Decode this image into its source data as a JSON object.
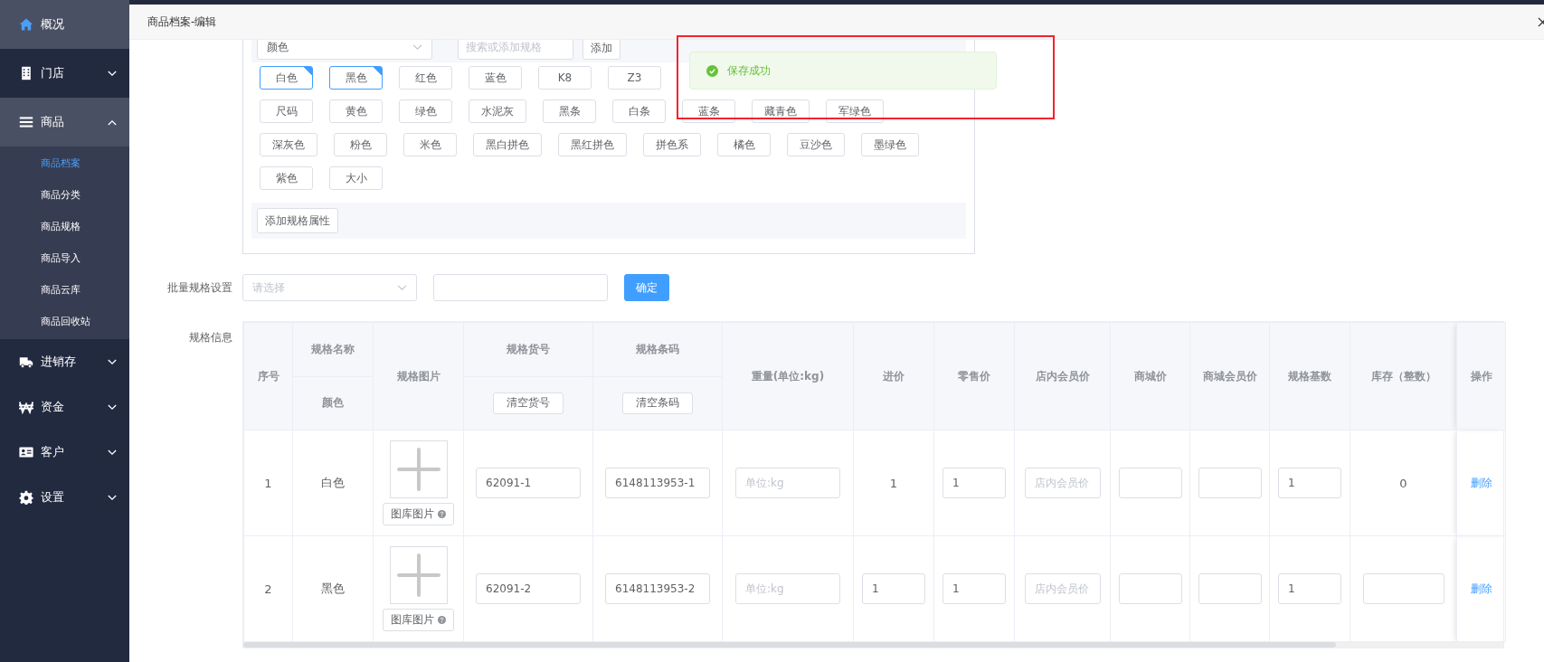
{
  "sidebar": {
    "items": [
      {
        "label": "概况",
        "highlighted": true
      },
      {
        "label": "门店",
        "highlighted": false,
        "expanded": false
      },
      {
        "label": "商品",
        "highlighted": true,
        "expanded": true,
        "children": [
          {
            "label": "商品档案",
            "selected": true
          },
          {
            "label": "商品分类",
            "selected": false
          },
          {
            "label": "商品规格",
            "selected": false
          },
          {
            "label": "商品导入",
            "selected": false
          },
          {
            "label": "商品云库",
            "selected": false
          },
          {
            "label": "商品回收站",
            "selected": false
          }
        ]
      },
      {
        "label": "进销存",
        "highlighted": false,
        "expanded": false
      },
      {
        "label": "资金",
        "highlighted": false,
        "expanded": false
      },
      {
        "label": "客户",
        "highlighted": false,
        "expanded": false
      },
      {
        "label": "设置",
        "highlighted": false,
        "expanded": false
      }
    ]
  },
  "modal": {
    "title": "商品档案-编辑"
  },
  "spec_panel": {
    "attribute_select": {
      "value": "颜色"
    },
    "search": {
      "placeholder": "搜索或添加规格"
    },
    "add_button": "添加",
    "tag_rows": [
      [
        {
          "label": "白色",
          "selected": true
        },
        {
          "label": "黑色",
          "selected": true
        },
        {
          "label": "红色",
          "selected": false
        },
        {
          "label": "蓝色",
          "selected": false
        },
        {
          "label": "K8",
          "selected": false
        },
        {
          "label": "Z3",
          "selected": false
        }
      ],
      [
        {
          "label": "尺码",
          "selected": false
        },
        {
          "label": "黄色",
          "selected": false
        },
        {
          "label": "绿色",
          "selected": false
        },
        {
          "label": "水泥灰",
          "selected": false
        },
        {
          "label": "黑条",
          "selected": false
        },
        {
          "label": "白条",
          "selected": false
        },
        {
          "label": "蓝条",
          "selected": false
        },
        {
          "label": "藏青色",
          "selected": false
        },
        {
          "label": "军绿色",
          "selected": false
        }
      ],
      [
        {
          "label": "深灰色",
          "selected": false
        },
        {
          "label": "粉色",
          "selected": false
        },
        {
          "label": "米色",
          "selected": false
        },
        {
          "label": "黑白拼色",
          "selected": false
        },
        {
          "label": "黑红拼色",
          "selected": false
        },
        {
          "label": "拼色系",
          "selected": false
        },
        {
          "label": "橘色",
          "selected": false
        },
        {
          "label": "豆沙色",
          "selected": false
        },
        {
          "label": "墨绿色",
          "selected": false
        }
      ],
      [
        {
          "label": "紫色",
          "selected": false
        },
        {
          "label": "大小",
          "selected": false
        }
      ]
    ],
    "add_attribute_button": "添加规格属性"
  },
  "batch": {
    "label": "批量规格设置",
    "select": {
      "placeholder": "请选择"
    },
    "confirm_button": "确定"
  },
  "spec_table": {
    "label": "规格信息",
    "columns": [
      {
        "kind": "plain",
        "title": "序号"
      },
      {
        "kind": "sub_text",
        "title": "规格名称",
        "sub": "颜色"
      },
      {
        "kind": "plain",
        "title": "规格图片"
      },
      {
        "kind": "sub_button",
        "title": "规格货号",
        "sub": "清空货号"
      },
      {
        "kind": "sub_button",
        "title": "规格条码",
        "sub": "清空条码"
      },
      {
        "kind": "plain",
        "title": "重量(单位:kg)"
      },
      {
        "kind": "plain",
        "title": "进价"
      },
      {
        "kind": "plain",
        "title": "零售价"
      },
      {
        "kind": "plain",
        "title": "店内会员价"
      },
      {
        "kind": "plain",
        "title": "商城价"
      },
      {
        "kind": "plain",
        "title": "商城会员价"
      },
      {
        "kind": "plain",
        "title": "规格基数"
      },
      {
        "kind": "plain",
        "title": "库存（整数）"
      },
      {
        "kind": "plain",
        "title": "操作"
      }
    ],
    "rows": [
      {
        "cells": [
          {
            "kind": "text",
            "value": "1"
          },
          {
            "kind": "text",
            "value": "白色"
          },
          {
            "kind": "image",
            "button": "图库图片"
          },
          {
            "kind": "input",
            "value": "62091-1"
          },
          {
            "kind": "input",
            "value": "6148113953-1"
          },
          {
            "kind": "input",
            "placeholder": "单位:kg"
          },
          {
            "kind": "text",
            "value": "1"
          },
          {
            "kind": "input",
            "value": "1"
          },
          {
            "kind": "input",
            "placeholder": "店内会员价"
          },
          {
            "kind": "input"
          },
          {
            "kind": "input"
          },
          {
            "kind": "input",
            "value": "1"
          },
          {
            "kind": "text",
            "value": "0"
          },
          {
            "kind": "link",
            "value": "删除"
          }
        ]
      },
      {
        "cells": [
          {
            "kind": "text",
            "value": "2"
          },
          {
            "kind": "text",
            "value": "黑色"
          },
          {
            "kind": "image",
            "button": "图库图片"
          },
          {
            "kind": "input",
            "value": "62091-2"
          },
          {
            "kind": "input",
            "value": "6148113953-2"
          },
          {
            "kind": "input",
            "placeholder": "单位:kg"
          },
          {
            "kind": "input",
            "value": "1"
          },
          {
            "kind": "input",
            "value": "1"
          },
          {
            "kind": "input",
            "placeholder": "店内会员价"
          },
          {
            "kind": "input"
          },
          {
            "kind": "input"
          },
          {
            "kind": "input",
            "value": "1"
          },
          {
            "kind": "input"
          },
          {
            "kind": "link",
            "value": "删除"
          }
        ]
      }
    ]
  },
  "toast": {
    "message": "保存成功"
  }
}
